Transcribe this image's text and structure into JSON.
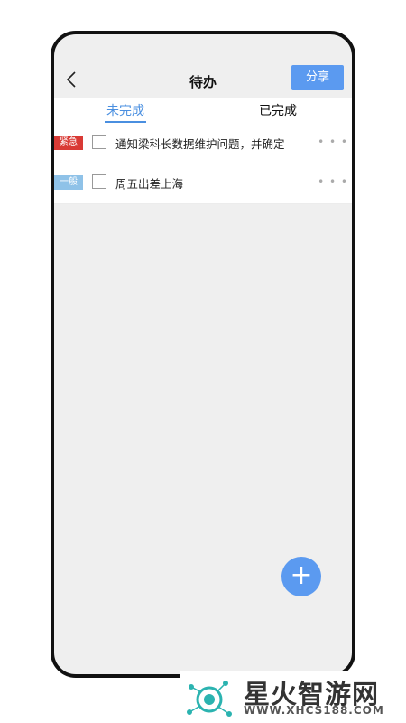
{
  "header": {
    "back_icon": "chevron-left-icon",
    "title": "待办",
    "share_label": "分享"
  },
  "tabs": [
    {
      "label": "未完成",
      "active": true
    },
    {
      "label": "已完成",
      "active": false
    }
  ],
  "tasks": [
    {
      "priority": "紧急",
      "text": "通知梁科长数据维护问题，并确定",
      "checked": false,
      "more": "• • •"
    },
    {
      "priority": "一般",
      "text": "周五出差上海",
      "checked": false,
      "more": "• • •"
    }
  ],
  "fab": {
    "label": "+",
    "icon": "plus-icon"
  },
  "watermark": {
    "title": "星火智游网",
    "url": "WWW.XHCS188.COM"
  },
  "colors": {
    "accent": "#5b9af0",
    "urgent": "#d93a35",
    "normal": "#8fc2e8"
  }
}
